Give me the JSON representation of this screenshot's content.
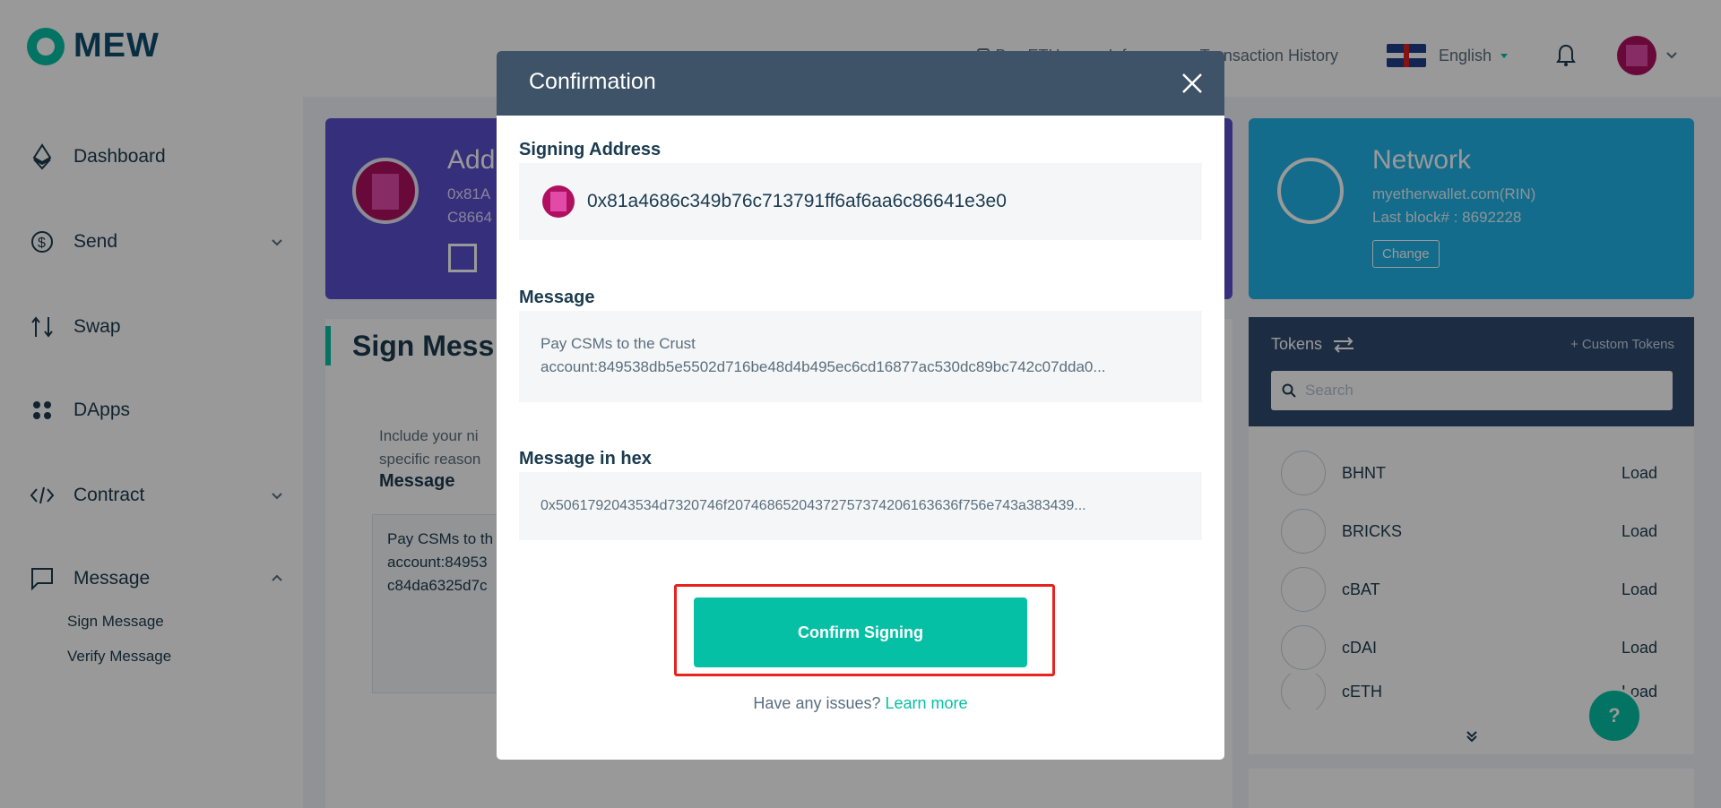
{
  "header": {
    "logo_text": "MEW",
    "nav": {
      "buy_eth": "Buy ETH",
      "info": "Info",
      "transaction_history": "Transaction History",
      "language": "English"
    }
  },
  "sidebar": {
    "items": [
      {
        "label": "Dashboard",
        "icon": "eth-icon"
      },
      {
        "label": "Send",
        "icon": "send-icon"
      },
      {
        "label": "Swap",
        "icon": "swap-icon"
      },
      {
        "label": "DApps",
        "icon": "dapps-icon"
      },
      {
        "label": "Contract",
        "icon": "code-icon"
      },
      {
        "label": "Message",
        "icon": "message-icon"
      }
    ],
    "sub_items": [
      "Sign Message",
      "Verify Message"
    ]
  },
  "address_card": {
    "title": "Add",
    "line1": "0x81A",
    "line2": "C8664"
  },
  "network_card": {
    "title": "Network",
    "url": "myetherwallet.com(RIN)",
    "last_block": "Last block# : 8692228",
    "change_label": "Change"
  },
  "sign_panel": {
    "title": "Sign Mess",
    "desc_line1": "Include your ni",
    "desc_line2": "specific reason",
    "message_label": "Message",
    "message_line1": "Pay CSMs to th",
    "message_line2": "account:84953",
    "message_line3": "c84da6325d7c"
  },
  "tokens": {
    "title": "Tokens",
    "custom_label": "+ Custom Tokens",
    "search_placeholder": "Search",
    "load_label": "Load",
    "list": [
      "BHNT",
      "BRICKS",
      "cBAT",
      "cDAI",
      "cETH"
    ]
  },
  "modal": {
    "title": "Confirmation",
    "signing_address_label": "Signing Address",
    "signing_address": "0x81a4686c349b76c713791ff6af6aa6c86641e3e0",
    "message_label": "Message",
    "message_line1": "Pay CSMs to the Crust",
    "message_line2": "account:849538db5e5502d716be48d4b495ec6cd16877ac530dc89bc742c07dda0...",
    "hex_label": "Message in hex",
    "hex_value": "0x5061792043534d7320746f20746865204372757374206163636f756e743a383439...",
    "confirm_label": "Confirm Signing",
    "issues_text": "Have any issues?",
    "learn_more": "Learn more"
  },
  "help_label": "?",
  "colors": {
    "accent": "#05c0a5",
    "modal_header": "#3e5367",
    "address_card": "#5a4fcf",
    "network_card": "#21b5e8",
    "highlight": "#e8221c"
  }
}
